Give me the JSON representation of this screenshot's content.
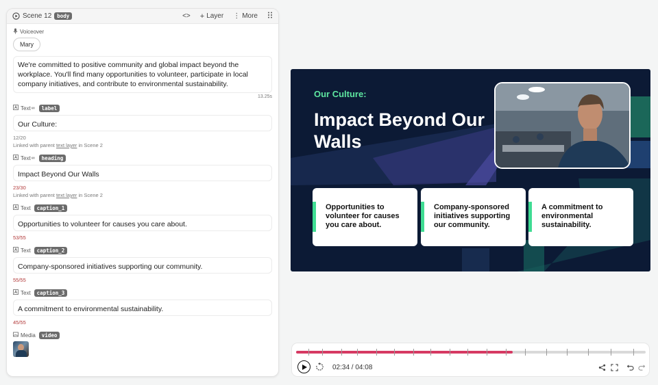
{
  "panel": {
    "scene_title": "Scene 12",
    "scene_tag": "body",
    "code_label": "<>",
    "layer_label": "Layer",
    "more_label": "More",
    "voiceover_label": "Voiceover",
    "voice_name": "Mary",
    "voiceover_text": "We're committed to positive community and global impact beyond the workplace. You'll find many opportunities to volunteer, participate in local company initiatives, and contribute to environmental sustainability.",
    "voiceover_duration": "13.25s",
    "fields": [
      {
        "kind": "Text",
        "tag": "label",
        "value": "Our Culture:",
        "count": "12/20",
        "linked_prefix": "Linked with parent",
        "linked_link": "text layer",
        "linked_suffix": "in Scene 2"
      },
      {
        "kind": "Text",
        "tag": "heading",
        "value": "Impact Beyond Our Walls",
        "count": "23/30",
        "linked_prefix": "Linked with parent",
        "linked_link": "text layer",
        "linked_suffix": "in Scene 2"
      },
      {
        "kind": "Text",
        "tag": "caption_1",
        "value": "Opportunities to volunteer for causes you care about.",
        "count": "53/55"
      },
      {
        "kind": "Text",
        "tag": "caption_2",
        "value": "Company-sponsored initiatives supporting our community.",
        "count": "55/55"
      },
      {
        "kind": "Text",
        "tag": "caption_3",
        "value": "A commitment to environmental sustainability.",
        "count": "45/55"
      }
    ],
    "media_label": "Media",
    "media_tag": "video"
  },
  "slide": {
    "eyebrow": "Our Culture:",
    "headline": "Impact Beyond Our Walls",
    "cards": [
      "Opportunities to volunteer for causes you care about.",
      "Company-sponsored initiatives supporting our community.",
      "A commitment to environmental sustainability."
    ],
    "colors": {
      "accent": "#5ee6a0",
      "background": "#0c1a35",
      "card_bar": "#3fdc93"
    }
  },
  "player": {
    "time": "02:34 / 04:08",
    "progress": 0.62,
    "progress_color": "#d63a63"
  }
}
